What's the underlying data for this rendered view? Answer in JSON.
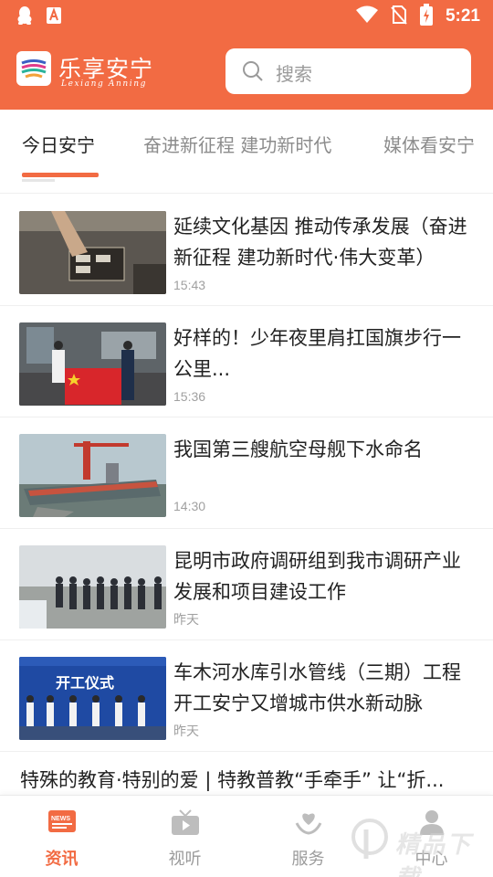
{
  "status_bar": {
    "time": "5:21",
    "icons": [
      "qq-icon",
      "text-app-icon",
      "wifi-icon",
      "no-sim-icon",
      "battery-charging-icon"
    ]
  },
  "header": {
    "brand_name": "乐享安宁",
    "brand_sub": "Lexiang Anning",
    "search_placeholder": "搜索"
  },
  "tabs": [
    {
      "label": "今日安宁",
      "active": true
    },
    {
      "label": "奋进新征程 建功新时代",
      "active": false
    },
    {
      "label": "媒体看安宁",
      "active": false
    }
  ],
  "news": [
    {
      "title": "延续文化基因 推动传承发展（奋进新征程 建功新时代·伟大变革）",
      "time": "15:43",
      "thumb": "craft-workshop-photo"
    },
    {
      "title": "好样的！少年夜里肩扛国旗步行一公里...",
      "time": "15:36",
      "thumb": "boy-with-flag-photo"
    },
    {
      "title": "我国第三艘航空母舰下水命名",
      "time": "14:30",
      "thumb": "aircraft-carrier-photo"
    },
    {
      "title": "昆明市政府调研组到我市调研产业发展和项目建设工作",
      "time": "昨天",
      "thumb": "inspection-group-photo"
    },
    {
      "title": "车木河水库引水管线（三期）工程开工安宁又增城市供水新动脉",
      "time": "昨天",
      "thumb": "opening-ceremony-photo"
    }
  ],
  "thumb_texts": {
    "ceremony_banner": "开工仪式"
  },
  "text_only_item": {
    "title": "特殊的教育·特别的爱 | 特教普教“手牵手” 让“折..."
  },
  "bottom_nav": [
    {
      "label": "资讯",
      "icon": "news-icon",
      "active": true
    },
    {
      "label": "视听",
      "icon": "video-icon",
      "active": false
    },
    {
      "label": "服务",
      "icon": "service-heart-icon",
      "active": false
    },
    {
      "label": "中心",
      "icon": "user-icon",
      "active": false
    }
  ],
  "watermark": {
    "text": "精品下载"
  },
  "colors": {
    "accent": "#f26b43",
    "tab_active": "#222222",
    "tab_inactive": "#8c8c8c",
    "time_text": "#a0a0a0"
  }
}
